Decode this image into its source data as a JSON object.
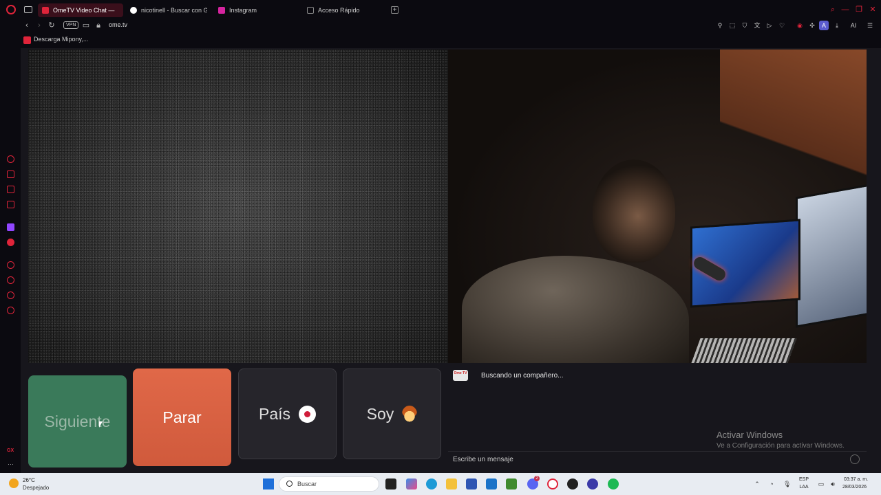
{
  "browser": {
    "tabs": [
      {
        "label": "OmeTV Video Chat —",
        "active": true,
        "favicon_color": "#e0243a"
      },
      {
        "label": "nicotinell - Buscar con Go",
        "active": false,
        "favicon_color": "#ffffff"
      },
      {
        "label": "Instagram",
        "active": false,
        "favicon_color": "#d6249f"
      },
      {
        "label": "Acceso Rápido",
        "active": false,
        "favicon_color": "#888888"
      }
    ],
    "new_tab_label": "+",
    "vpn_label": "VPN",
    "url": "ome.tv",
    "profile_letter": "A",
    "ai_label": "AI",
    "bookmark": "Descarga Mipony,..."
  },
  "sidebar": {
    "gx_label": "GX",
    "more_label": "···"
  },
  "controls": {
    "next_label": "Siguiente",
    "stop_label": "Parar",
    "country_label": "País",
    "iam_label": "Soy"
  },
  "chat": {
    "logo_text": "Ome TV",
    "status": "Buscando un compañero...",
    "input_placeholder": "Escribe un mensaje",
    "watermark_title": "Activar Windows",
    "watermark_sub": "Ve a Configuración para activar Windows."
  },
  "taskbar": {
    "temperature": "26°C",
    "weather": "Despejado",
    "search_placeholder": "Buscar",
    "language_top": "ESP",
    "language_bottom": "LAA",
    "time": "03:37 a. m.",
    "date": "28/03/2026",
    "discord_badge": "2"
  },
  "colors": {
    "accent": "#e0243a",
    "next_button": "#3a7a5a",
    "stop_button": "#e06848"
  }
}
